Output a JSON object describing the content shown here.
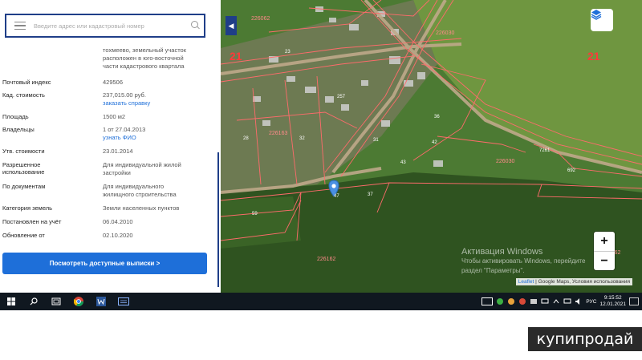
{
  "search": {
    "placeholder": "Введите адрес или кадастровый номер"
  },
  "details": {
    "address_lines": [
      "тохмеево, земельный участок",
      "расположен в юго-восточной",
      "части кадастрового квартала"
    ],
    "rows": [
      {
        "label": "Почтовый индекс",
        "value": "429506"
      },
      {
        "label": "Кад. стоимость",
        "value": "237,015.00 руб.",
        "link": "заказать справку"
      },
      {
        "label": "Площадь",
        "value": "1500 м2"
      },
      {
        "label": "Владельцы",
        "value": "1 от 27.04.2013",
        "link": "узнать ФИО"
      },
      {
        "label": "Утв. стоимости",
        "value": "23.01.2014"
      },
      {
        "label": "Разрешенное",
        "label2": "использование",
        "value": "Для индивидуальной жилой",
        "value2": "застройки"
      },
      {
        "label": "По документам",
        "value": "Для индивидуального",
        "value2": "жилищного строительства"
      },
      {
        "label": "Категория земель",
        "value": "Земли населенных пунктов"
      },
      {
        "label": "Постановлен на учёт",
        "value": "06.04.2010"
      },
      {
        "label": "Обновление от",
        "value": "02.10.2020"
      }
    ],
    "cta_label": "Посмотреть доступные выписки >"
  },
  "map": {
    "parcel_labels": [
      "226062",
      "226030",
      "226163",
      "226162",
      "226162",
      "226030"
    ],
    "zone_labels": [
      "21",
      "21"
    ],
    "plot_numbers": [
      "23",
      "257",
      "28",
      "42",
      "36",
      "43",
      "32",
      "37",
      "46",
      "31",
      "47",
      "59",
      "35",
      "40",
      "30",
      "12",
      "692",
      "7261"
    ],
    "zoom_in": "+",
    "zoom_out": "−",
    "collapse": "◀",
    "watermark_title": "Активация Windows",
    "watermark_line1": "Чтобы активировать Windows, перейдите",
    "watermark_line2": "раздел \"Параметры\".",
    "attribution_leaflet": "Leaflet",
    "attribution_rest": "| Google Maps, Условия использования"
  },
  "taskbar": {
    "lang": "РУС",
    "time": "9:15:52",
    "date": "12.01.2021"
  },
  "brand": "купипродай",
  "colors": {
    "accent": "#1e6fd9",
    "panel_border": "#1f3e88",
    "parcel_line": "#ff6b6b"
  }
}
